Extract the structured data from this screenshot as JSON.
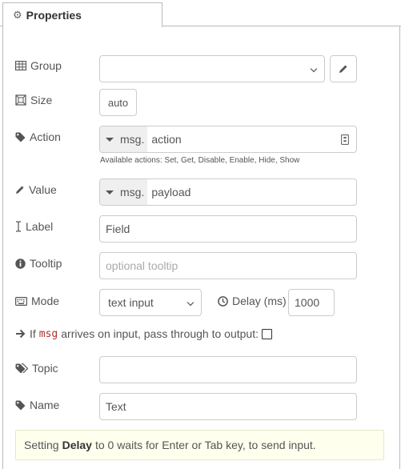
{
  "tab": {
    "label": "Properties",
    "icon": "gear-icon"
  },
  "group": {
    "label": "Group",
    "value": ""
  },
  "size": {
    "label": "Size",
    "value": "auto"
  },
  "action": {
    "label": "Action",
    "type_prefix": "msg.",
    "value": "action",
    "hint": "Available actions: Set, Get, Disable, Enable, Hide, Show"
  },
  "value_field": {
    "label": "Value",
    "type_prefix": "msg.",
    "value": "payload"
  },
  "label_field": {
    "label": "Label",
    "value": "Field"
  },
  "tooltip": {
    "label": "Tooltip",
    "placeholder": "optional tooltip"
  },
  "mode": {
    "label": "Mode",
    "selected": "text input"
  },
  "delay": {
    "label": "Delay (ms)",
    "value": "1000"
  },
  "passthrough": {
    "prefix": "If",
    "code": "msg",
    "suffix": "arrives on input, pass through to output:",
    "checked": false
  },
  "topic": {
    "label": "Topic",
    "value": ""
  },
  "name": {
    "label": "Name",
    "value": "Text"
  },
  "info": {
    "prefix": "Setting",
    "bold": "Delay",
    "suffix": "to 0 waits for Enter or Tab key, to send input."
  }
}
